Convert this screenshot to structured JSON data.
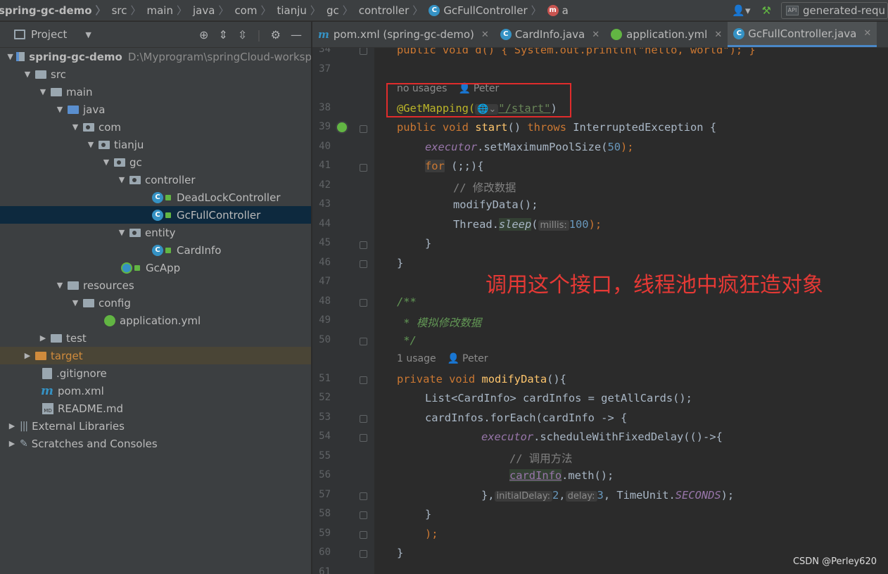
{
  "navbar": {
    "breadcrumbs": [
      "spring-gc-demo",
      "src",
      "main",
      "java",
      "com",
      "tianju",
      "gc",
      "controller",
      "GcFullController",
      "a"
    ],
    "run_config": "generated-requ"
  },
  "project": {
    "title": "Project",
    "tree": [
      {
        "label": "spring-gc-demo",
        "path": "D:\\Myprogram\\springCloud-worksp"
      },
      {
        "label": "src"
      },
      {
        "label": "main"
      },
      {
        "label": "java"
      },
      {
        "label": "com"
      },
      {
        "label": "tianju"
      },
      {
        "label": "gc"
      },
      {
        "label": "controller"
      },
      {
        "label": "DeadLockController"
      },
      {
        "label": "GcFullController"
      },
      {
        "label": "entity"
      },
      {
        "label": "CardInfo"
      },
      {
        "label": "GcApp"
      },
      {
        "label": "resources"
      },
      {
        "label": "config"
      },
      {
        "label": "application.yml"
      },
      {
        "label": "test"
      },
      {
        "label": "target"
      },
      {
        "label": ".gitignore"
      },
      {
        "label": "pom.xml"
      },
      {
        "label": "README.md"
      },
      {
        "label": "External Libraries"
      },
      {
        "label": "Scratches and Consoles"
      }
    ]
  },
  "tabs": [
    {
      "label": "pom.xml (spring-gc-demo)"
    },
    {
      "label": "CardInfo.java"
    },
    {
      "label": "application.yml"
    },
    {
      "label": "GcFullController.java"
    }
  ],
  "editor": {
    "line_numbers": [
      "34",
      "37",
      "38",
      "39",
      "40",
      "41",
      "42",
      "43",
      "44",
      "45",
      "46",
      "47",
      "48",
      "49",
      "50",
      "51",
      "52",
      "53",
      "54",
      "55",
      "56",
      "57",
      "58",
      "59",
      "60",
      "61"
    ],
    "hints": {
      "no_usages": "no usages",
      "author": "Peter",
      "one_usage": "1 usage",
      "author2": "Peter"
    },
    "lines": {
      "l34": "public void d() { System.out.println(\"hello, world\"); }",
      "l38_ann": "@GetMapping(",
      "l38_str": "\"/start\"",
      "l38_end": ")",
      "l39_a": "public void ",
      "l39_fn": "start",
      "l39_b": "() ",
      "l39_kw": "throws",
      "l39_c": " InterruptedException {",
      "l40_f": "executor",
      "l40_b": ".setMaximumPoolSize(",
      "l40_n": "50",
      "l40_c": ");",
      "l41_kw": "for",
      "l41_b": " (;;){",
      "l42": "// 修改数据",
      "l43": "modifyData();",
      "l44_a": "Thread.",
      "l44_fn": "sleep",
      "l44_b": "(",
      "l44_hint": "millis:",
      "l44_n": "100",
      "l44_c": ");",
      "l45": "}",
      "l46": "}",
      "l48": "/**",
      "l49": " * 模拟修改数据",
      "l50": " */",
      "l51_kw": "private void ",
      "l51_fn": "modifyData",
      "l51_b": "(){",
      "l52_a": "List<CardInfo> cardInfos = getAllCards();",
      "l53": "cardInfos.forEach(cardInfo -> {",
      "l54_f": "executor",
      "l54_b": ".scheduleWithFixedDelay(()->{",
      "l55": "// 调用方法",
      "l56_u": "cardInfo",
      "l56_b": ".meth();",
      "l57_a": "},",
      "l57_h1": "initialDelay:",
      "l57_n1": "2",
      "l57_comma": ",",
      "l57_h2": "delay:",
      "l57_n2": "3",
      "l57_b": ", TimeUnit.",
      "l57_c": "SECONDS",
      "l57_d": ");",
      "l58": "}",
      "l59": ");",
      "l60": "}"
    }
  },
  "annotation_text": "调用这个接口，线程池中疯狂造对象",
  "watermark": "CSDN @Perley620",
  "colors": {
    "annotation": "#e53935",
    "selection": "#0d293e",
    "keyword": "#cc7832",
    "string": "#6a8759"
  }
}
